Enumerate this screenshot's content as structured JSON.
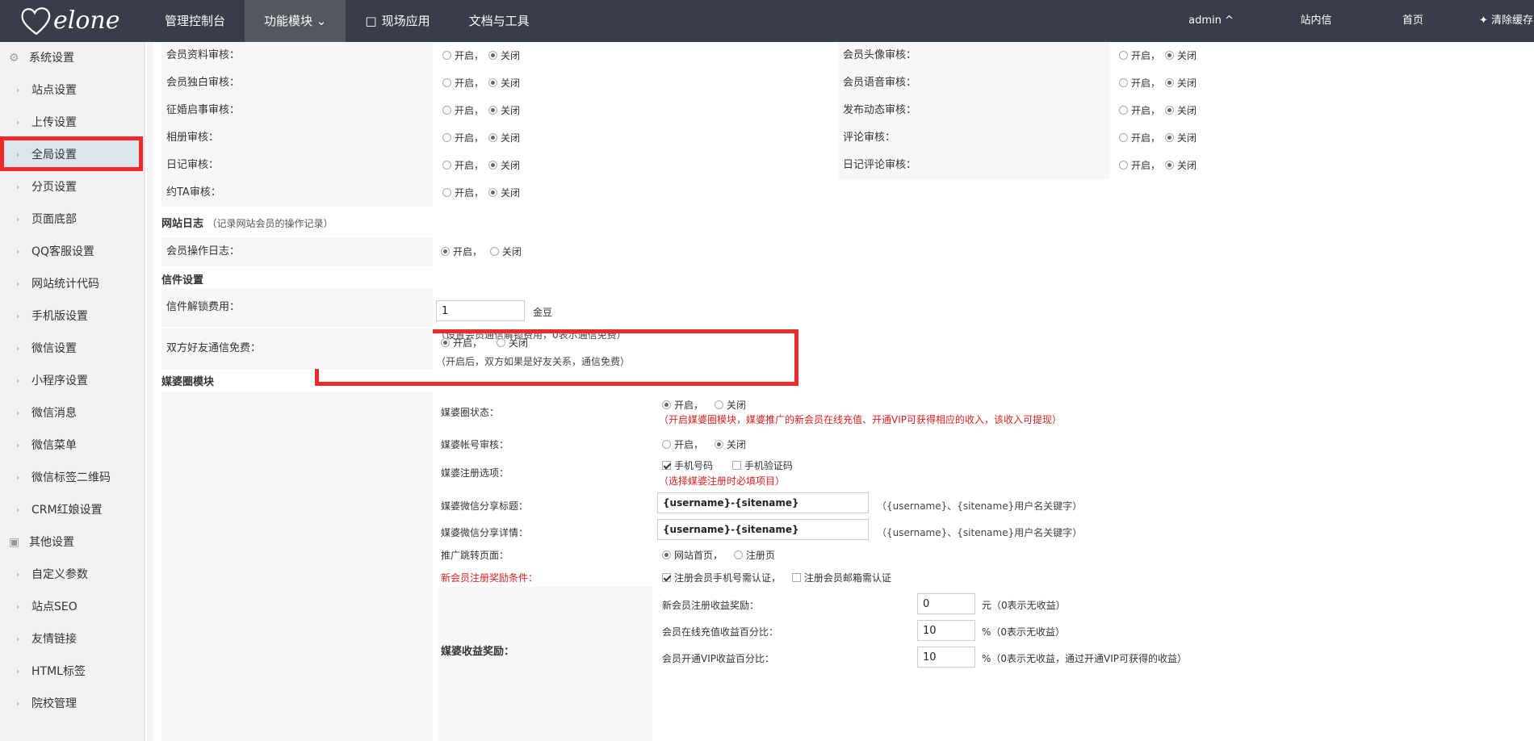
{
  "header": {
    "logo_text": "elone",
    "nav": [
      {
        "label": "管理控制台"
      },
      {
        "label": "功能模块",
        "active": true
      },
      {
        "label": "现场应用"
      },
      {
        "label": "文档与工具"
      }
    ],
    "user": "admin ^",
    "mail": "站内信",
    "home": "首页",
    "clear_cache": "清除缓存"
  },
  "sidebar": {
    "group1": "系统设置",
    "items1": [
      "站点设置",
      "上传设置",
      "全局设置",
      "分页设置",
      "页面底部",
      "QQ客服设置",
      "网站统计代码",
      "手机版设置",
      "微信设置",
      "小程序设置",
      "微信消息",
      "微信菜单",
      "微信标签二维码",
      "CRM红娘设置"
    ],
    "group2": "其他设置",
    "items2": [
      "自定义参数",
      "站点SEO",
      "友情链接",
      "HTML标签",
      "院校管理"
    ],
    "selected": "全局设置"
  },
  "options": {
    "on": "开启，",
    "off": "关闭",
    "on_short": "开启"
  },
  "audit_rows": [
    {
      "left": "会员资料审核：",
      "left_on": false,
      "right": "会员头像审核：",
      "right_on": false
    },
    {
      "left": "会员独白审核：",
      "left_on": false,
      "right": "会员语音审核：",
      "right_on": false
    },
    {
      "left": "征婚启事审核：",
      "left_on": false,
      "right": "发布动态审核：",
      "right_on": false
    },
    {
      "left": "相册审核：",
      "left_on": false,
      "right": "评论审核：",
      "right_on": false
    },
    {
      "left": "日记审核：",
      "left_on": false,
      "right": "日记评论审核：",
      "right_on": false
    },
    {
      "left": "约TA审核：",
      "left_on": false
    }
  ],
  "site_log": {
    "title": "网站日志",
    "note": "（记录网站会员的操作记录）",
    "label": "会员操作日志：",
    "on": true
  },
  "letter": {
    "title": "信件设置",
    "unlock_label": "信件解锁费用：",
    "unlock_value": "1",
    "unit": "金豆",
    "unlock_hint": "（设置会员通信解锁费用，0表示通信免费）",
    "friend_label": "双方好友通信免费：",
    "friend_hint": "（开启后，双方如果是好友关系，通信免费）"
  },
  "matchmaker": {
    "title": "媒婆圈模块",
    "status_label": "媒婆圈状态：",
    "status_hint": "（开启媒婆圈模块，媒婆推广的新会员在线充值、开通VIP可获得相应的收入，该收入可提现）",
    "account_label": "媒婆帐号审核：",
    "reg_label": "媒婆注册选项：",
    "reg_opt1": "手机号码",
    "reg_opt2": "手机验证码",
    "reg_hint": "（选择媒婆注册时必填项目）",
    "share_title_label": "媒婆微信分享标题：",
    "share_title_value": "{username}-{sitename}",
    "share_title_hint": "（{username}、{sitename}用户名关键字）",
    "share_detail_label": "媒婆微信分享详情：",
    "share_detail_value": "{username}-{sitename}",
    "share_detail_hint": "（{username}、{sitename}用户名关键字）",
    "jump_label": "推广跳转页面：",
    "jump_opt1": "网站首页，",
    "jump_opt2": "注册页",
    "reward_cond_label": "新会员注册奖励条件：",
    "reward_cond1": "注册会员手机号需认证，",
    "reward_cond2": "注册会员邮箱需认证",
    "income_label": "媒婆收益奖励：",
    "income_rows": [
      {
        "label": "新会员注册收益奖励：",
        "value": "0",
        "unit": "元（0表示无收益）"
      },
      {
        "label": "会员在线充值收益百分比：",
        "value": "10",
        "unit": "%（0表示无收益）"
      },
      {
        "label": "会员开通VIP收益百分比：",
        "value": "10",
        "unit": "%（0表示无收益，通过开通VIP可获得的收益）"
      }
    ]
  }
}
